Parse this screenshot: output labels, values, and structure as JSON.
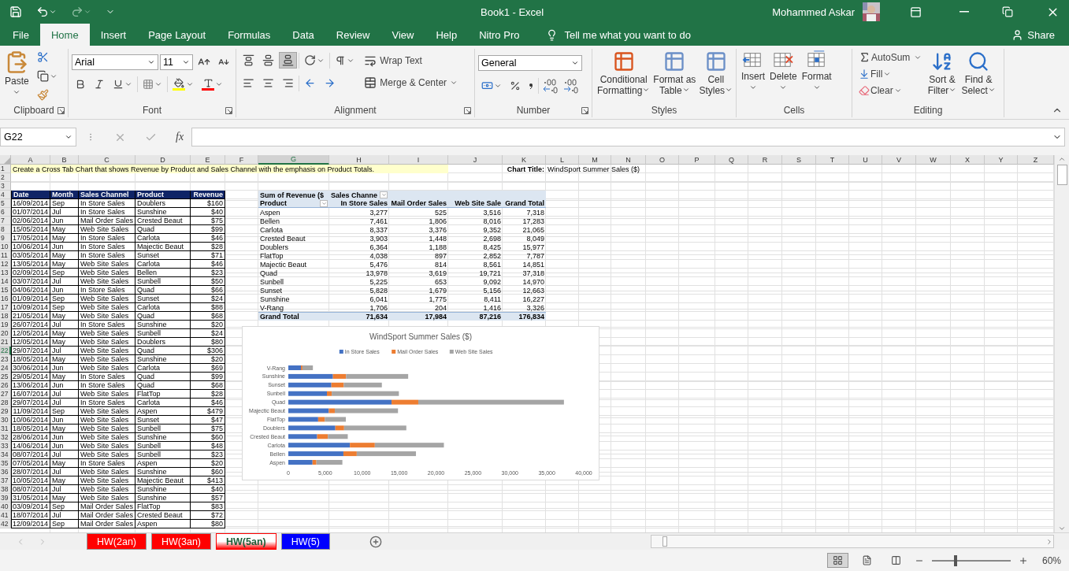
{
  "window": {
    "title": "Book1  -  Excel",
    "user": "Mohammed Askar"
  },
  "menu_tabs": [
    {
      "label": "File",
      "selected": false
    },
    {
      "label": "Home",
      "selected": true
    },
    {
      "label": "Insert",
      "selected": false
    },
    {
      "label": "Page Layout",
      "selected": false
    },
    {
      "label": "Formulas",
      "selected": false
    },
    {
      "label": "Data",
      "selected": false
    },
    {
      "label": "Review",
      "selected": false
    },
    {
      "label": "View",
      "selected": false
    },
    {
      "label": "Help",
      "selected": false
    },
    {
      "label": "Nitro Pro",
      "selected": false
    }
  ],
  "tell_me": "Tell me what you want to do",
  "share": "Share",
  "ribbon": {
    "clipboard": {
      "paste": "Paste",
      "label": "Clipboard"
    },
    "font": {
      "name": "Arial",
      "size": "11",
      "label": "Font"
    },
    "alignment": {
      "wrap_text": "Wrap Text",
      "merge": "Merge & Center",
      "label": "Alignment"
    },
    "number": {
      "format": "General",
      "label": "Number"
    },
    "styles": {
      "buttons": [
        "Conditional\nFormatting",
        "Format as\nTable",
        "Cell\nStyles"
      ],
      "label": "Styles"
    },
    "cells": {
      "buttons": [
        "Insert",
        "Delete",
        "Format"
      ],
      "label": "Cells"
    },
    "editing": {
      "autosum": "AutoSum",
      "fill": "Fill",
      "clear": "Clear",
      "sort": "Sort &\nFilter",
      "find": "Find &\nSelect",
      "label": "Editing"
    }
  },
  "formula_bar": {
    "name_box": "G22",
    "function_label": "fx"
  },
  "columns": [
    {
      "label": "A",
      "selected": false
    },
    {
      "label": "B",
      "selected": false
    },
    {
      "label": "C",
      "selected": false
    },
    {
      "label": "D",
      "selected": false
    },
    {
      "label": "E",
      "selected": false
    },
    {
      "label": "F",
      "selected": false
    },
    {
      "label": "G",
      "selected": true
    },
    {
      "label": "H",
      "selected": false
    },
    {
      "label": "I",
      "selected": false
    },
    {
      "label": "J",
      "selected": false
    },
    {
      "label": "K",
      "selected": false
    },
    {
      "label": "L",
      "selected": false
    },
    {
      "label": "M",
      "selected": false
    },
    {
      "label": "N",
      "selected": false
    },
    {
      "label": "O",
      "selected": false
    },
    {
      "label": "P",
      "selected": false
    },
    {
      "label": "Q",
      "selected": false
    },
    {
      "label": "R",
      "selected": false
    },
    {
      "label": "S",
      "selected": false
    },
    {
      "label": "T",
      "selected": false
    },
    {
      "label": "U",
      "selected": false
    },
    {
      "label": "V",
      "selected": false
    },
    {
      "label": "W",
      "selected": false
    },
    {
      "label": "X",
      "selected": false
    },
    {
      "label": "Y",
      "selected": false
    },
    {
      "label": "Z",
      "selected": false
    }
  ],
  "rows": [
    {
      "label": "1",
      "selected": false
    },
    {
      "label": "2",
      "selected": false
    },
    {
      "label": "3",
      "selected": false
    },
    {
      "label": "4",
      "selected": false
    },
    {
      "label": "5",
      "selected": false
    },
    {
      "label": "6",
      "selected": false
    },
    {
      "label": "7",
      "selected": false
    },
    {
      "label": "8",
      "selected": false
    },
    {
      "label": "9",
      "selected": false
    },
    {
      "label": "10",
      "selected": false
    },
    {
      "label": "11",
      "selected": false
    },
    {
      "label": "12",
      "selected": false
    },
    {
      "label": "13",
      "selected": false
    },
    {
      "label": "14",
      "selected": false
    },
    {
      "label": "15",
      "selected": false
    },
    {
      "label": "16",
      "selected": false
    },
    {
      "label": "17",
      "selected": false
    },
    {
      "label": "18",
      "selected": false
    },
    {
      "label": "19",
      "selected": false
    },
    {
      "label": "20",
      "selected": false
    },
    {
      "label": "21",
      "selected": false
    },
    {
      "label": "22",
      "selected": true
    },
    {
      "label": "23",
      "selected": false
    },
    {
      "label": "24",
      "selected": false
    },
    {
      "label": "25",
      "selected": false
    },
    {
      "label": "26",
      "selected": false
    },
    {
      "label": "27",
      "selected": false
    },
    {
      "label": "28",
      "selected": false
    },
    {
      "label": "29",
      "selected": false
    },
    {
      "label": "30",
      "selected": false
    },
    {
      "label": "31",
      "selected": false
    },
    {
      "label": "32",
      "selected": false
    },
    {
      "label": "33",
      "selected": false
    },
    {
      "label": "34",
      "selected": false
    },
    {
      "label": "35",
      "selected": false
    },
    {
      "label": "36",
      "selected": false
    },
    {
      "label": "37",
      "selected": false
    },
    {
      "label": "38",
      "selected": false
    },
    {
      "label": "39",
      "selected": false
    },
    {
      "label": "40",
      "selected": false
    },
    {
      "label": "41",
      "selected": false
    },
    {
      "label": "42",
      "selected": false
    }
  ],
  "note": "Create a Cross Tab Chart that shows Revenue by Product and Sales Channel with the emphasis on Product Totals.",
  "chart_title_label": "Chart Title:",
  "chart_title_value": "WindSport Summer Sales ($)",
  "data_table": {
    "columns": [
      "Date",
      "Month",
      "Sales Channel",
      "Product",
      "Revenue"
    ],
    "rows": [
      [
        "16/09/2014",
        "Sep",
        "In Store Sales",
        "Doublers",
        "$160"
      ],
      [
        "01/07/2014",
        "Jul",
        "In Store Sales",
        "Sunshine",
        "$40"
      ],
      [
        "02/06/2014",
        "Jun",
        "Mail Order Sales",
        "Crested Beaut",
        "$75"
      ],
      [
        "15/05/2014",
        "May",
        "Web Site Sales",
        "Quad",
        "$99"
      ],
      [
        "17/05/2014",
        "May",
        "In Store Sales",
        "Carlota",
        "$46"
      ],
      [
        "10/06/2014",
        "Jun",
        "In Store Sales",
        "Majectic Beaut",
        "$28"
      ],
      [
        "03/05/2014",
        "May",
        "In Store Sales",
        "Sunset",
        "$71"
      ],
      [
        "13/05/2014",
        "May",
        "Web Site Sales",
        "Carlota",
        "$46"
      ],
      [
        "02/09/2014",
        "Sep",
        "Web Site Sales",
        "Bellen",
        "$23"
      ],
      [
        "03/07/2014",
        "Jul",
        "Web Site Sales",
        "Sunbell",
        "$50"
      ],
      [
        "04/06/2014",
        "Jun",
        "In Store Sales",
        "Quad",
        "$66"
      ],
      [
        "01/09/2014",
        "Sep",
        "Web Site Sales",
        "Sunset",
        "$24"
      ],
      [
        "10/09/2014",
        "Sep",
        "Web Site Sales",
        "Carlota",
        "$88"
      ],
      [
        "21/05/2014",
        "May",
        "Web Site Sales",
        "Quad",
        "$68"
      ],
      [
        "26/07/2014",
        "Jul",
        "In Store Sales",
        "Sunshine",
        "$20"
      ],
      [
        "12/05/2014",
        "May",
        "Web Site Sales",
        "Sunbell",
        "$24"
      ],
      [
        "12/05/2014",
        "May",
        "Web Site Sales",
        "Doublers",
        "$80"
      ],
      [
        "29/07/2014",
        "Jul",
        "Web Site Sales",
        "Quad",
        "$306"
      ],
      [
        "18/05/2014",
        "May",
        "Web Site Sales",
        "Sunshine",
        "$20"
      ],
      [
        "30/06/2014",
        "Jun",
        "Web Site Sales",
        "Carlota",
        "$69"
      ],
      [
        "29/05/2014",
        "May",
        "In Store Sales",
        "Quad",
        "$99"
      ],
      [
        "13/06/2014",
        "Jun",
        "In Store Sales",
        "Quad",
        "$68"
      ],
      [
        "16/07/2014",
        "Jul",
        "Web Site Sales",
        "FlatTop",
        "$28"
      ],
      [
        "29/07/2014",
        "Jul",
        "In Store Sales",
        "Carlota",
        "$46"
      ],
      [
        "11/09/2014",
        "Sep",
        "Web Site Sales",
        "Aspen",
        "$479"
      ],
      [
        "10/06/2014",
        "Jun",
        "Web Site Sales",
        "Sunset",
        "$47"
      ],
      [
        "18/05/2014",
        "May",
        "Web Site Sales",
        "Sunbell",
        "$75"
      ],
      [
        "28/06/2014",
        "Jun",
        "Web Site Sales",
        "Sunshine",
        "$60"
      ],
      [
        "14/06/2014",
        "Jun",
        "Web Site Sales",
        "Sunbell",
        "$48"
      ],
      [
        "08/07/2014",
        "Jul",
        "Web Site Sales",
        "Sunbell",
        "$23"
      ],
      [
        "07/05/2014",
        "May",
        "In Store Sales",
        "Aspen",
        "$20"
      ],
      [
        "28/07/2014",
        "Jul",
        "Web Site Sales",
        "Sunshine",
        "$60"
      ],
      [
        "10/05/2014",
        "May",
        "Web Site Sales",
        "Majectic Beaut",
        "$413"
      ],
      [
        "08/07/2014",
        "Jul",
        "Web Site Sales",
        "Sunshine",
        "$40"
      ],
      [
        "31/05/2014",
        "May",
        "Web Site Sales",
        "Sunshine",
        "$57"
      ],
      [
        "03/09/2014",
        "Sep",
        "Mail Order Sales",
        "FlatTop",
        "$83"
      ],
      [
        "18/07/2014",
        "Jul",
        "Mail Order Sales",
        "Crested Beaut",
        "$72"
      ],
      [
        "12/09/2014",
        "Sep",
        "Mail Order Sales",
        "Aspen",
        "$80"
      ]
    ]
  },
  "pivot": {
    "header_top": [
      "Sum of Revenue ($",
      "Sales Channe"
    ],
    "columns": [
      "Product",
      "In Store Sales",
      "Mail Order Sales",
      "Web Site Sale",
      "Grand Total"
    ],
    "rows": [
      [
        "Aspen",
        "3,277",
        "525",
        "3,516",
        "7,318"
      ],
      [
        "Bellen",
        "7,461",
        "1,806",
        "8,016",
        "17,283"
      ],
      [
        "Carlota",
        "8,337",
        "3,376",
        "9,352",
        "21,065"
      ],
      [
        "Crested Beaut",
        "3,903",
        "1,448",
        "2,698",
        "8,049"
      ],
      [
        "Doublers",
        "6,364",
        "1,188",
        "8,425",
        "15,977"
      ],
      [
        "FlatTop",
        "4,038",
        "897",
        "2,852",
        "7,787"
      ],
      [
        "Majectic Beaut",
        "5,476",
        "814",
        "8,561",
        "14,851"
      ],
      [
        "Quad",
        "13,978",
        "3,619",
        "19,721",
        "37,318"
      ],
      [
        "Sunbell",
        "5,225",
        "653",
        "9,092",
        "14,970"
      ],
      [
        "Sunset",
        "5,828",
        "1,679",
        "5,156",
        "12,663"
      ],
      [
        "Sunshine",
        "6,041",
        "1,775",
        "8,411",
        "16,227"
      ],
      [
        "V-Rang",
        "1,706",
        "204",
        "1,416",
        "3,326"
      ]
    ],
    "total": [
      "Grand Total",
      "71,634",
      "17,984",
      "87,216",
      "176,834"
    ]
  },
  "chart": {
    "chart_data": {
      "type": "bar",
      "orientation": "horizontal",
      "stacked": true,
      "title": "WindSport Summer Sales ($)",
      "legend": "top",
      "categories": [
        "V-Rang",
        "Sunshine",
        "Sunset",
        "Sunbell",
        "Quad",
        "Majectic Beaut",
        "FlatTop",
        "Doublers",
        "Crested Beaut",
        "Carlota",
        "Bellen",
        "Aspen"
      ],
      "series": [
        {
          "name": "In Store Sales",
          "color": "#4472c4",
          "values": [
            1706,
            6041,
            5828,
            5225,
            13978,
            5476,
            4038,
            6364,
            3903,
            8337,
            7461,
            3277
          ]
        },
        {
          "name": "Mail Order Sales",
          "color": "#ed7d31",
          "values": [
            204,
            1775,
            1679,
            653,
            3619,
            814,
            897,
            1188,
            1448,
            3376,
            1806,
            525
          ]
        },
        {
          "name": "Web Site Sales",
          "color": "#a5a5a5",
          "values": [
            1416,
            8411,
            5156,
            9092,
            19721,
            8561,
            2852,
            8425,
            2698,
            9352,
            8016,
            3516
          ]
        }
      ],
      "xlim": [
        0,
        40000
      ],
      "xticks": [
        {
          "value": 0,
          "label": "0"
        },
        {
          "value": 5000,
          "label": "5,000"
        },
        {
          "value": 10000,
          "label": "10,000"
        },
        {
          "value": 15000,
          "label": "15,000"
        },
        {
          "value": 20000,
          "label": "20,000"
        },
        {
          "value": 25000,
          "label": "25,000"
        },
        {
          "value": 30000,
          "label": "30,000"
        },
        {
          "value": 35000,
          "label": "35,000"
        },
        {
          "value": 40000,
          "label": "40,000"
        }
      ]
    }
  },
  "sheet_tabs": [
    {
      "label": "HW(2an)",
      "color": "#ff0000",
      "selected": false
    },
    {
      "label": "HW(3an)",
      "color": "#ff0000",
      "selected": false
    },
    {
      "label": "HW(5an)",
      "color": "#ff0000",
      "selected": true
    },
    {
      "label": "HW(5)",
      "color": "#0000ff",
      "selected": false
    }
  ],
  "status_bar": {
    "zoom": "60%",
    "zoom_slider": {
      "level": 0.3
    }
  }
}
